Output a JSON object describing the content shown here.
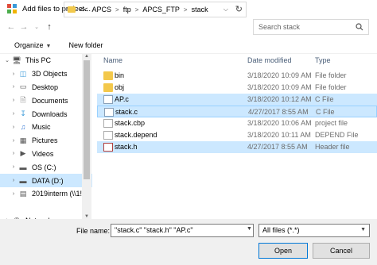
{
  "window": {
    "title": "Add files to project..."
  },
  "address": {
    "overflow": "<<",
    "crumbs": [
      "APCS",
      "ftp",
      "APCS_FTP",
      "stack"
    ],
    "separator": ">"
  },
  "search": {
    "placeholder": "Search stack"
  },
  "toolbar": {
    "organize": "Organize",
    "new_folder": "New folder"
  },
  "nav": {
    "items": [
      {
        "label": "This PC",
        "icon": "pc-icon",
        "expander": "v"
      },
      {
        "label": "3D Objects",
        "icon": "cube-icon",
        "expander": ">"
      },
      {
        "label": "Desktop",
        "icon": "desktop-icon",
        "expander": ">"
      },
      {
        "label": "Documents",
        "icon": "documents-icon",
        "expander": ">"
      },
      {
        "label": "Downloads",
        "icon": "download-icon",
        "expander": ">"
      },
      {
        "label": "Music",
        "icon": "music-icon",
        "expander": ">"
      },
      {
        "label": "Pictures",
        "icon": "pictures-icon",
        "expander": ">"
      },
      {
        "label": "Videos",
        "icon": "videos-icon",
        "expander": ">"
      },
      {
        "label": "OS (C:)",
        "icon": "drive-icon",
        "expander": ">"
      },
      {
        "label": "DATA (D:)",
        "icon": "drive-icon",
        "expander": ">"
      },
      {
        "label": "2019interm (\\\\1!",
        "icon": "network-drive-icon",
        "expander": ">"
      },
      {
        "label": "",
        "icon": "",
        "expander": ""
      },
      {
        "label": "Network",
        "icon": "network-icon",
        "expander": ">"
      }
    ]
  },
  "columns": {
    "name": "Name",
    "date": "Date modified",
    "type": "Type"
  },
  "files": [
    {
      "name": "bin",
      "date": "3/18/2020 10:09 AM",
      "type": "File folder",
      "kind": "folder"
    },
    {
      "name": "obj",
      "date": "3/18/2020 10:09 AM",
      "type": "File folder",
      "kind": "folder"
    },
    {
      "name": "AP.c",
      "date": "3/18/2020 10:12 AM",
      "type": "C File",
      "kind": "c"
    },
    {
      "name": "stack.c",
      "date": "4/27/2017 8:55 AM",
      "type": "C File",
      "kind": "c"
    },
    {
      "name": "stack.cbp",
      "date": "3/18/2020 10:06 AM",
      "type": "project file",
      "kind": "gen"
    },
    {
      "name": "stack.depend",
      "date": "3/18/2020 10:11 AM",
      "type": "DEPEND File",
      "kind": "gen"
    },
    {
      "name": "stack.h",
      "date": "4/27/2017 8:55 AM",
      "type": "Header file",
      "kind": "h"
    }
  ],
  "bottom": {
    "file_name_label": "File name:",
    "file_name_value": "\"stack.c\" \"stack.h\" \"AP.c\"",
    "filter": "All files (*.*)",
    "open": "Open",
    "cancel": "Cancel"
  },
  "colors": {
    "selection": "#cce8ff",
    "focus_border": "#99d1ff",
    "folder": "#f3c84b"
  }
}
